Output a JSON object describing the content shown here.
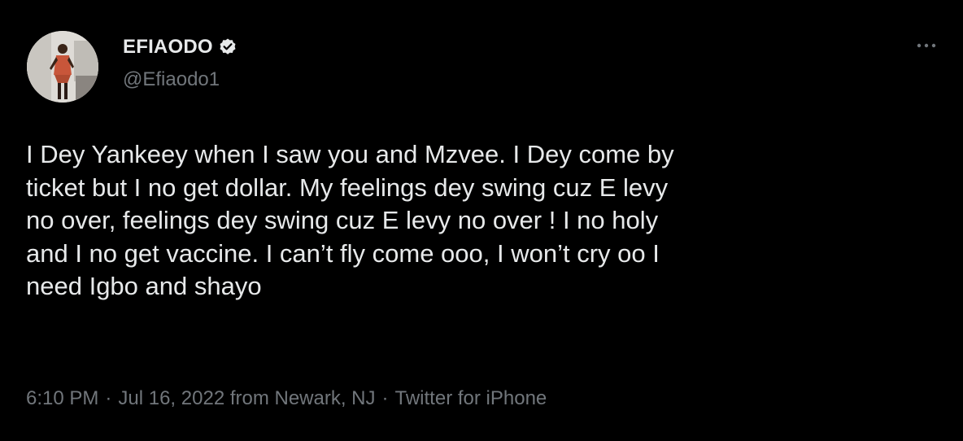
{
  "author": {
    "display_name": "EFIAODO",
    "handle": "@Efiaodo1",
    "verified": true,
    "avatar_icon": "profile-photo"
  },
  "tweet": {
    "text": "I Dey Yankeey when I saw you and  Mzvee. I Dey come by\nticket but I no get dollar. My feelings dey swing cuz E levy\nno over,  feelings dey swing cuz E levy no over ! I no holy\nand I no get vaccine. I can’t fly come ooo, I won’t cry oo I\nneed Igbo and shayo"
  },
  "meta": {
    "time": "6:10 PM",
    "separator": "·",
    "date_location": "Jul 16, 2022 from Newark, NJ",
    "source": "Twitter for iPhone"
  },
  "icons": {
    "more": "more-horizontal-icon",
    "verified": "verified-badge-icon"
  },
  "colors": {
    "background": "#000000",
    "primary_text": "#e7e9ea",
    "secondary_text": "#71767b",
    "verified_badge": "#e7e9ea"
  }
}
